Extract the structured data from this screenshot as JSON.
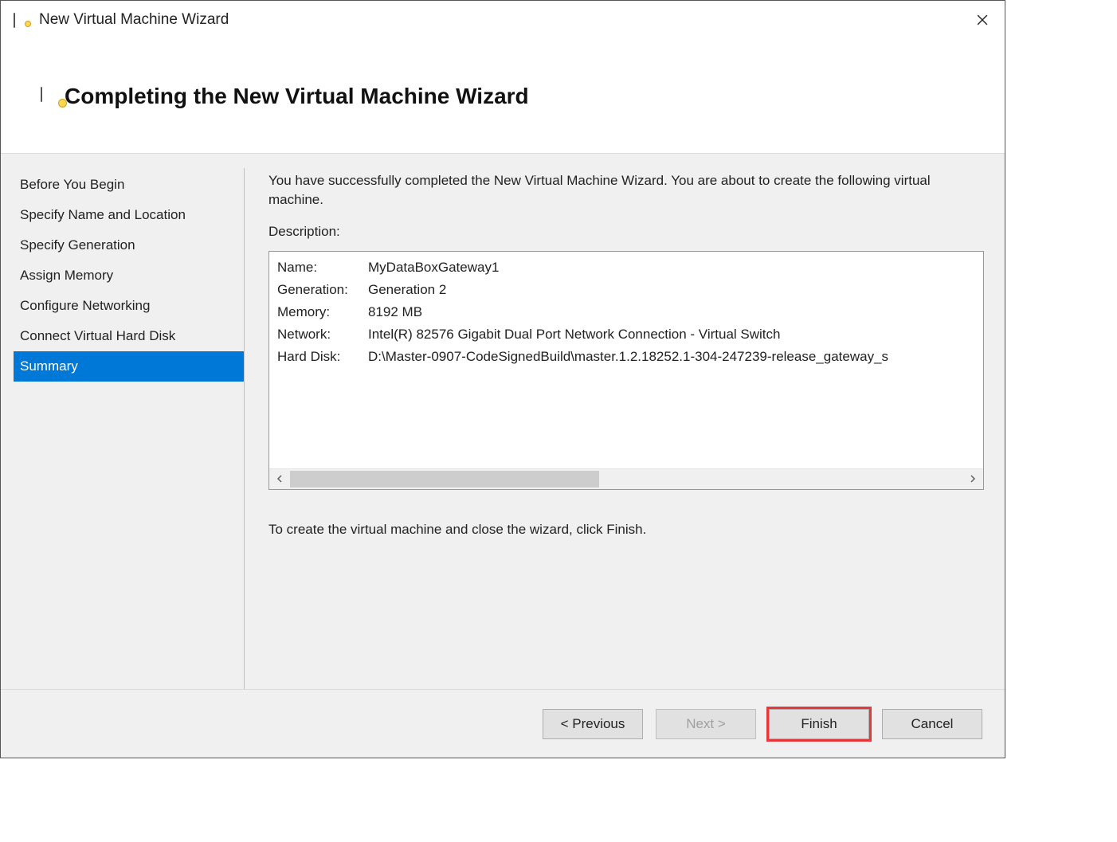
{
  "window": {
    "title": "New Virtual Machine Wizard"
  },
  "header": {
    "heading": "Completing the New Virtual Machine Wizard"
  },
  "steps": {
    "items": [
      {
        "label": "Before You Begin",
        "selected": false
      },
      {
        "label": "Specify Name and Location",
        "selected": false
      },
      {
        "label": "Specify Generation",
        "selected": false
      },
      {
        "label": "Assign Memory",
        "selected": false
      },
      {
        "label": "Configure Networking",
        "selected": false
      },
      {
        "label": "Connect Virtual Hard Disk",
        "selected": false
      },
      {
        "label": "Summary",
        "selected": true
      }
    ]
  },
  "content": {
    "intro": "You have successfully completed the New Virtual Machine Wizard. You are about to create the following virtual machine.",
    "description_label": "Description:",
    "properties": [
      {
        "key": "Name:",
        "value": "MyDataBoxGateway1"
      },
      {
        "key": "Generation:",
        "value": "Generation 2"
      },
      {
        "key": "Memory:",
        "value": "8192 MB"
      },
      {
        "key": "Network:",
        "value": "Intel(R) 82576 Gigabit Dual Port Network Connection - Virtual Switch"
      },
      {
        "key": "Hard Disk:",
        "value": "D:\\Master-0907-CodeSignedBuild\\master.1.2.18252.1-304-247239-release_gateway_s"
      }
    ],
    "footer_text": "To create the virtual machine and close the wizard, click Finish."
  },
  "buttons": {
    "previous": "< Previous",
    "next": "Next >",
    "finish": "Finish",
    "cancel": "Cancel"
  }
}
